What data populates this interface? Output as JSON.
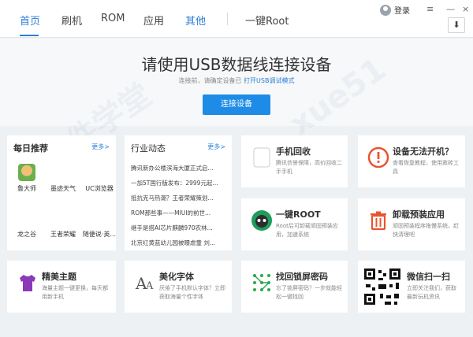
{
  "nav": {
    "tabs": [
      "首页",
      "刷机",
      "ROM",
      "应用",
      "其他",
      "一键Root"
    ],
    "login": "登录",
    "minimize": "≡",
    "close": "×"
  },
  "hero": {
    "title": "请使用USB数据线连接设备",
    "sub_prefix": "连接前，请确定设备已",
    "sub_link": "打开USB调试模式",
    "button": "连接设备"
  },
  "daily": {
    "title": "每日推荐",
    "more": "更多>",
    "apps": [
      "鲁大师",
      "墨迹天气",
      "UC浏览器",
      "龙之谷",
      "王者荣耀",
      "随便说·英..."
    ]
  },
  "industry": {
    "title": "行业动态",
    "more": "更多>",
    "news": [
      "腾讯新办公楼滨海大厦正式启...",
      "一加5T国行版发布：2999元起...",
      "抵抗克马热潮？王者荣耀策划...",
      "ROM那些事——MIUI的前世...",
      "继手是搭AI芯片麒麟970农林...",
      "北京红黄蓝幼儿园被曝虐童 刘..."
    ]
  },
  "tools": [
    {
      "title": "手机回收",
      "desc": "腾讯信誉保障，高价回收二手手机"
    },
    {
      "title": "设备无法开机？",
      "desc": "查看恢复教程，使用救砖工具"
    },
    {
      "title": "一键ROOT",
      "desc": "Root后可卸载顽固预装应用，加速系统"
    },
    {
      "title": "卸载预装应用",
      "desc": "顽固预装程序拖慢系统，赶快清理吧"
    },
    {
      "title": "精美主题",
      "desc": "海量主题一键更换，每天都用新手机"
    },
    {
      "title": "美化字体",
      "desc": "厌倦了手机默认字体？立即获取海量个性字体"
    },
    {
      "title": "找回锁屏密码",
      "desc": "忘了锁屏密码？一步就能轻松一键找回"
    },
    {
      "title": "微信扫一扫",
      "desc": "立即关注我们，获取最新玩机资讯"
    }
  ],
  "watermark": "软件学堂 www.xue51.com",
  "colors": {
    "accent": "#1e8ce6",
    "link": "#2b7fd6",
    "bg": "#eef1f4"
  }
}
